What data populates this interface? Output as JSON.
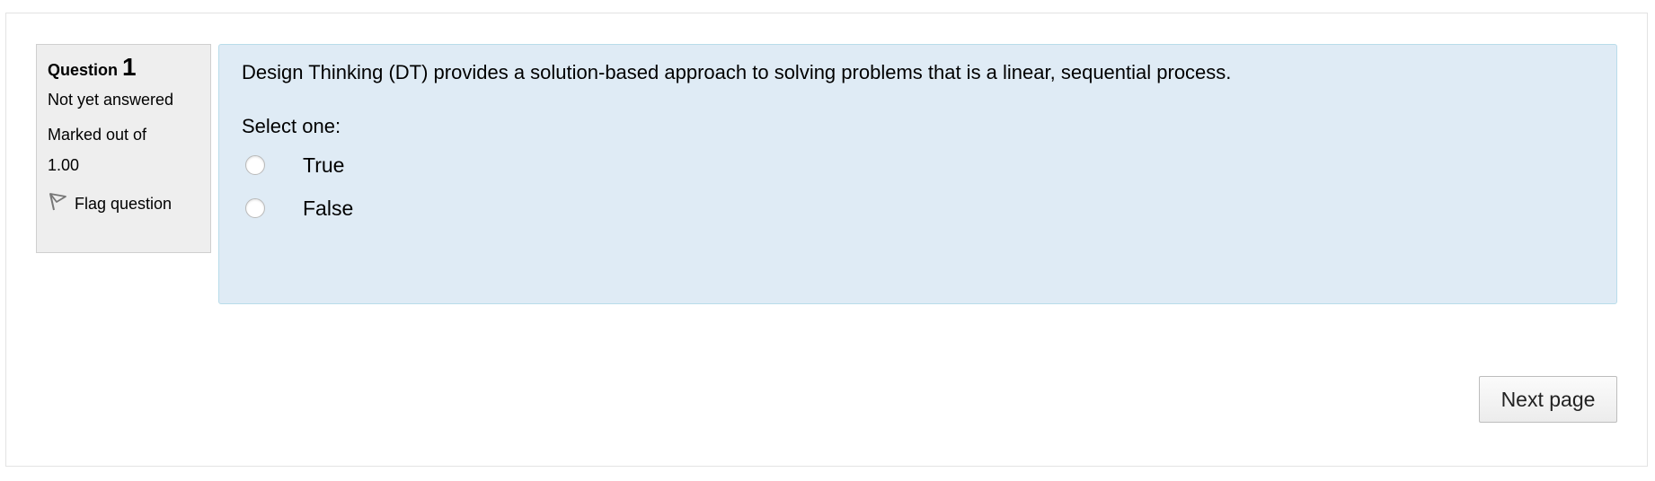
{
  "question_info": {
    "label": "Question",
    "number": "1",
    "state": "Not yet answered",
    "grade_line1": "Marked out of",
    "grade_line2": "1.00",
    "flag_label": "Flag question"
  },
  "question": {
    "text": "Design Thinking (DT) provides a solution-based approach to solving problems that is a linear, sequential process.",
    "prompt": "Select one:",
    "options": [
      {
        "label": "True",
        "selected": false
      },
      {
        "label": "False",
        "selected": false
      }
    ]
  },
  "navigation": {
    "next_label": "Next page"
  },
  "colors": {
    "content_bg": "#dfebf5",
    "content_border": "#b9dcea",
    "info_bg": "#eeeeee"
  },
  "icons": {
    "flag": "flag-icon"
  }
}
